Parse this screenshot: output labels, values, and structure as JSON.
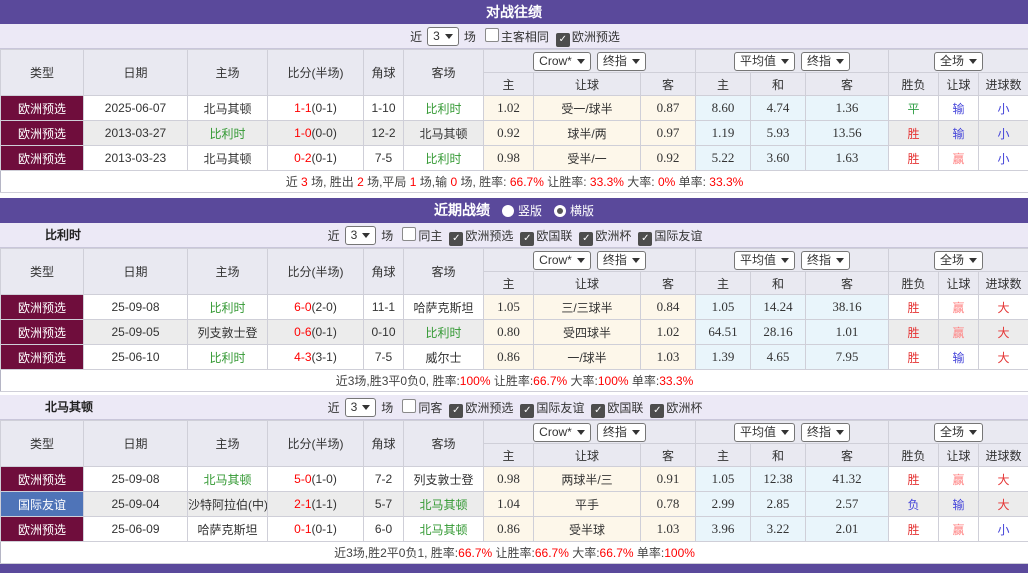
{
  "colors": {
    "title_bar": "#5a499b",
    "type_maroon": "#6f0d3c",
    "type_blue": "#4f74b8",
    "team_green": "#339933",
    "score_red": "#ff0000",
    "stat_red": "#e53434",
    "stat_pink": "#ff8282",
    "stat_blue": "#4444d9",
    "stat_green": "#2f9e44",
    "odds_bg": "#fdf7ea",
    "avg_bg": "#e9f5fb",
    "filter_bg": "#ece9f6",
    "header_bg": "#e9e9f1"
  },
  "header": {
    "cols": [
      "类型",
      "日期",
      "主场",
      "比分(半场)",
      "角球",
      "客场"
    ],
    "subs": [
      "主",
      "让球",
      "客",
      "主",
      "和",
      "客",
      "胜负",
      "让球",
      "进球数"
    ],
    "selects": {
      "odds_source": "Crow*",
      "odds_stage": "终指",
      "avg_source": "平均值",
      "avg_stage": "终指",
      "scope": "全场"
    }
  },
  "h2h": {
    "title": "对战往绩",
    "filter": {
      "near": "近",
      "count": "3",
      "games": "场",
      "toggles": [
        {
          "label": "主客相同",
          "checked": false
        },
        {
          "label": "欧洲预选",
          "checked": true
        }
      ]
    },
    "rows": [
      {
        "type": "欧洲预选",
        "tc": "maroon",
        "date": "2025-06-07",
        "home": "北马其顿",
        "hg": false,
        "score": "1-1",
        "half": "(0-1)",
        "corner": "1-10",
        "away": "比利时",
        "ag": true,
        "o1": "1.02",
        "hc": "受一/球半",
        "o2": "0.87",
        "a1": "8.60",
        "a2": "4.74",
        "a3": "1.36",
        "res": [
          "平",
          "green"
        ],
        "hres": [
          "输",
          "blue"
        ],
        "gres": [
          "小",
          "blue"
        ]
      },
      {
        "type": "欧洲预选",
        "tc": "maroon",
        "date": "2013-03-27",
        "home": "比利时",
        "hg": true,
        "score": "1-0",
        "half": "(0-0)",
        "corner": "12-2",
        "away": "北马其顿",
        "ag": false,
        "o1": "0.92",
        "hc": "球半/两",
        "o2": "0.97",
        "a1": "1.19",
        "a2": "5.93",
        "a3": "13.56",
        "res": [
          "胜",
          "red"
        ],
        "hres": [
          "输",
          "blue"
        ],
        "gres": [
          "小",
          "blue"
        ]
      },
      {
        "type": "欧洲预选",
        "tc": "maroon",
        "date": "2013-03-23",
        "home": "北马其顿",
        "hg": false,
        "score": "0-2",
        "half": "(0-1)",
        "corner": "7-5",
        "away": "比利时",
        "ag": true,
        "o1": "0.98",
        "hc": "受半/一",
        "o2": "0.92",
        "a1": "5.22",
        "a2": "3.60",
        "a3": "1.63",
        "res": [
          "胜",
          "red"
        ],
        "hres": [
          "赢",
          "pink"
        ],
        "gres": [
          "小",
          "blue"
        ]
      }
    ],
    "summary": [
      {
        "t": "近 ",
        "r": false
      },
      {
        "t": "3",
        "r": true
      },
      {
        "t": " 场, 胜出 ",
        "r": false
      },
      {
        "t": "2",
        "r": true
      },
      {
        "t": " 场,平局 ",
        "r": false
      },
      {
        "t": "1",
        "r": true
      },
      {
        "t": " 场,输 ",
        "r": false
      },
      {
        "t": "0",
        "r": true
      },
      {
        "t": " 场, 胜率: ",
        "r": false
      },
      {
        "t": "66.7%",
        "r": true
      },
      {
        "t": " 让胜率: ",
        "r": false
      },
      {
        "t": "33.3%",
        "r": true
      },
      {
        "t": " 大率: ",
        "r": false
      },
      {
        "t": "0%",
        "r": true
      },
      {
        "t": " 单率: ",
        "r": false
      },
      {
        "t": "33.3%",
        "r": true
      }
    ]
  },
  "recent": {
    "title": "近期战绩",
    "radios": [
      {
        "label": "竖版",
        "on": false
      },
      {
        "label": "横版",
        "on": true
      }
    ],
    "sections": [
      {
        "team": "比利时",
        "filter": {
          "near": "近",
          "count": "3",
          "games": "场",
          "toggles": [
            {
              "label": "同主",
              "checked": false
            },
            {
              "label": "欧洲预选",
              "checked": true
            },
            {
              "label": "欧国联",
              "checked": true
            },
            {
              "label": "欧洲杯",
              "checked": true
            },
            {
              "label": "国际友谊",
              "checked": true
            }
          ]
        },
        "rows": [
          {
            "type": "欧洲预选",
            "tc": "maroon",
            "date": "25-09-08",
            "home": "比利时",
            "hg": true,
            "score": "6-0",
            "half": "(2-0)",
            "corner": "11-1",
            "away": "哈萨克斯坦",
            "ag": false,
            "o1": "1.05",
            "hc": "三/三球半",
            "o2": "0.84",
            "a1": "1.05",
            "a2": "14.24",
            "a3": "38.16",
            "res": [
              "胜",
              "red"
            ],
            "hres": [
              "赢",
              "pink"
            ],
            "gres": [
              "大",
              "red"
            ]
          },
          {
            "type": "欧洲预选",
            "tc": "maroon",
            "date": "25-09-05",
            "home": "列支敦士登",
            "hg": false,
            "score": "0-6",
            "half": "(0-1)",
            "corner": "0-10",
            "away": "比利时",
            "ag": true,
            "o1": "0.80",
            "hc": "受四球半",
            "o2": "1.02",
            "a1": "64.51",
            "a2": "28.16",
            "a3": "1.01",
            "res": [
              "胜",
              "red"
            ],
            "hres": [
              "赢",
              "pink"
            ],
            "gres": [
              "大",
              "red"
            ]
          },
          {
            "type": "欧洲预选",
            "tc": "maroon",
            "date": "25-06-10",
            "home": "比利时",
            "hg": true,
            "score": "4-3",
            "half": "(3-1)",
            "corner": "7-5",
            "away": "威尔士",
            "ag": false,
            "o1": "0.86",
            "hc": "一/球半",
            "o2": "1.03",
            "a1": "1.39",
            "a2": "4.65",
            "a3": "7.95",
            "res": [
              "胜",
              "red"
            ],
            "hres": [
              "输",
              "blue"
            ],
            "gres": [
              "大",
              "red"
            ]
          }
        ],
        "summary": [
          {
            "t": "近3场,胜3平0负0, 胜率:",
            "r": false
          },
          {
            "t": "100%",
            "r": true
          },
          {
            "t": " 让胜率:",
            "r": false
          },
          {
            "t": "66.7%",
            "r": true
          },
          {
            "t": " 大率:",
            "r": false
          },
          {
            "t": "100%",
            "r": true
          },
          {
            "t": " 单率:",
            "r": false
          },
          {
            "t": "33.3%",
            "r": true
          }
        ]
      },
      {
        "team": "北马其顿",
        "filter": {
          "near": "近",
          "count": "3",
          "games": "场",
          "toggles": [
            {
              "label": "同客",
              "checked": false
            },
            {
              "label": "欧洲预选",
              "checked": true
            },
            {
              "label": "国际友谊",
              "checked": true
            },
            {
              "label": "欧国联",
              "checked": true
            },
            {
              "label": "欧洲杯",
              "checked": true
            }
          ]
        },
        "rows": [
          {
            "type": "欧洲预选",
            "tc": "maroon",
            "date": "25-09-08",
            "home": "北马其顿",
            "hg": true,
            "score": "5-0",
            "half": "(1-0)",
            "corner": "7-2",
            "away": "列支敦士登",
            "ag": false,
            "o1": "0.98",
            "hc": "两球半/三",
            "o2": "0.91",
            "a1": "1.05",
            "a2": "12.38",
            "a3": "41.32",
            "res": [
              "胜",
              "red"
            ],
            "hres": [
              "赢",
              "pink"
            ],
            "gres": [
              "大",
              "red"
            ]
          },
          {
            "type": "国际友谊",
            "tc": "blue",
            "date": "25-09-04",
            "home": "沙特阿拉伯(中)",
            "hg": false,
            "score": "2-1",
            "half": "(1-1)",
            "corner": "5-7",
            "away": "北马其顿",
            "ag": true,
            "o1": "1.04",
            "hc": "平手",
            "o2": "0.78",
            "a1": "2.99",
            "a2": "2.85",
            "a3": "2.57",
            "res": [
              "负",
              "blue"
            ],
            "hres": [
              "输",
              "blue"
            ],
            "gres": [
              "大",
              "red"
            ]
          },
          {
            "type": "欧洲预选",
            "tc": "maroon",
            "date": "25-06-09",
            "home": "哈萨克斯坦",
            "hg": false,
            "score": "0-1",
            "half": "(0-1)",
            "corner": "6-0",
            "away": "北马其顿",
            "ag": true,
            "o1": "0.86",
            "hc": "受半球",
            "o2": "1.03",
            "a1": "3.96",
            "a2": "3.22",
            "a3": "2.01",
            "res": [
              "胜",
              "red"
            ],
            "hres": [
              "赢",
              "pink"
            ],
            "gres": [
              "小",
              "blue"
            ]
          }
        ],
        "summary": [
          {
            "t": "近3场,胜2平0负1, 胜率:",
            "r": false
          },
          {
            "t": "66.7%",
            "r": true
          },
          {
            "t": " 让胜率:",
            "r": false
          },
          {
            "t": "66.7%",
            "r": true
          },
          {
            "t": " 大率:",
            "r": false
          },
          {
            "t": "66.7%",
            "r": true
          },
          {
            "t": " 单率:",
            "r": false
          },
          {
            "t": "100%",
            "r": true
          }
        ]
      }
    ]
  }
}
